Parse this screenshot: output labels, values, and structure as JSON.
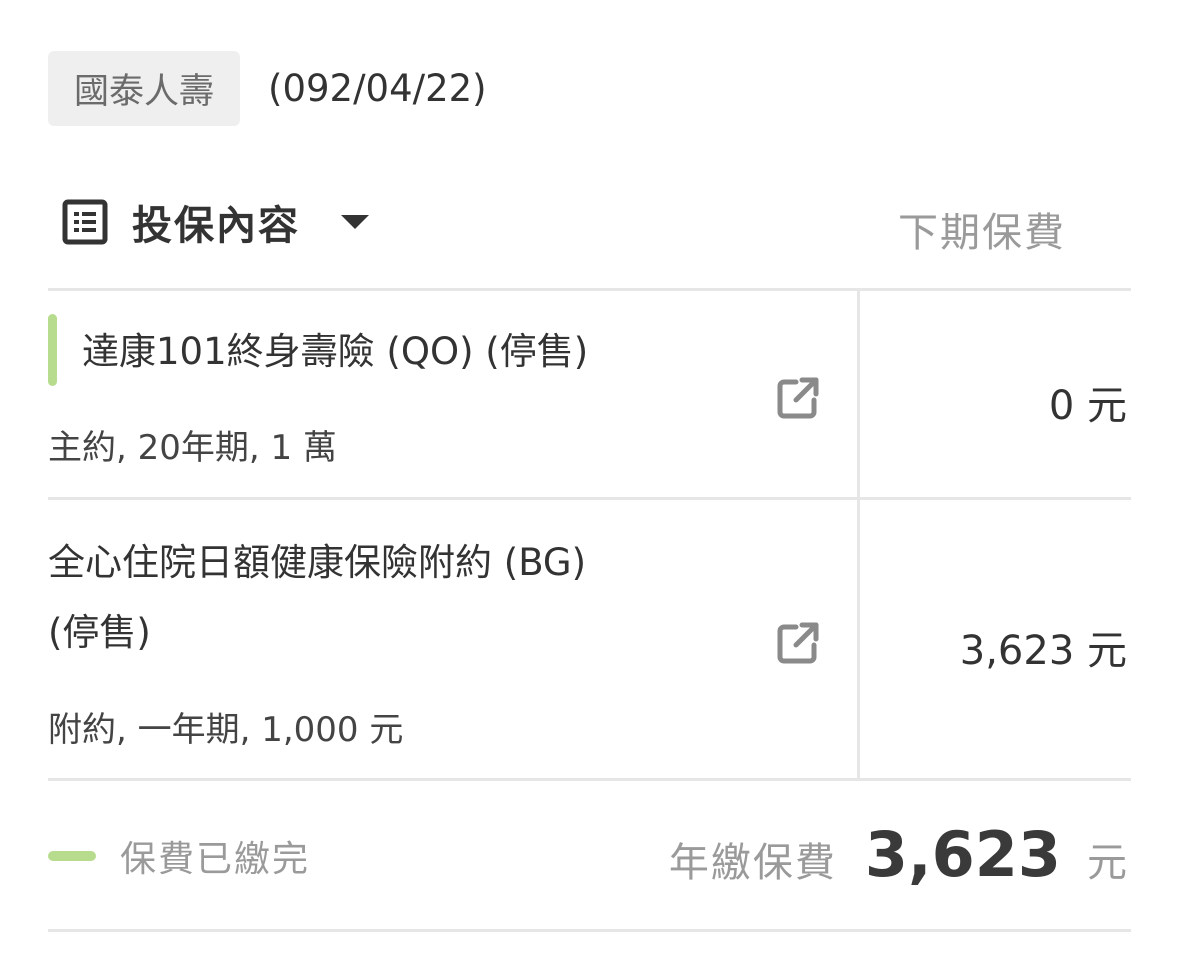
{
  "policy": {
    "company": "國泰人壽",
    "date": "(092/04/22)"
  },
  "section": {
    "title": "投保內容",
    "next_premium_label": "下期保費",
    "icons": {
      "list": "list-icon",
      "dropdown": "caret-down-icon",
      "external": "external-link-icon"
    }
  },
  "items": [
    {
      "title": "達康101終身壽險 (QO) (停售)",
      "details": "主約, 20年期, 1 萬",
      "premium": "0 元"
    },
    {
      "title_line1": "全心住院日額健康保險附約 (BG)",
      "title_line2": "(停售)",
      "details": "附約, 一年期, 1,000 元",
      "premium": "3,623 元"
    }
  ],
  "footer": {
    "paid_status": "保費已繳完",
    "annual_label": "年繳保費",
    "annual_value": "3,623",
    "annual_unit": "元"
  },
  "colors": {
    "paid_green": "#b7dc8d",
    "divider": "#e6e6e6",
    "badge_bg": "#efefef",
    "muted_text": "#9a9a9a"
  }
}
